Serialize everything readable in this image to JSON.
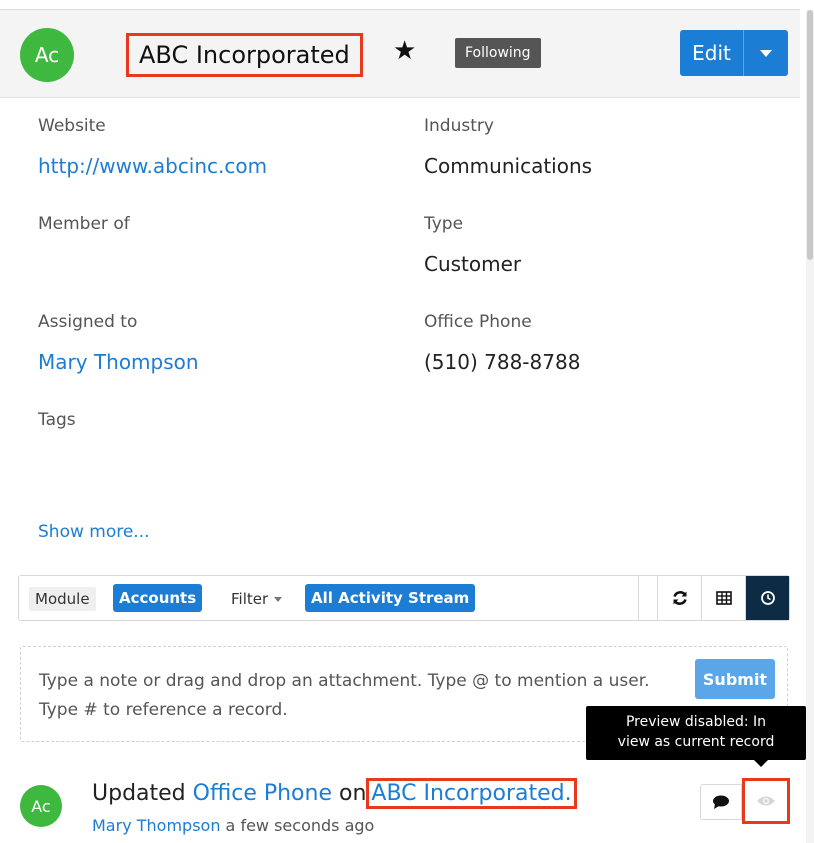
{
  "header": {
    "avatar_initials": "Ac",
    "record_name": "ABC Incorporated",
    "following_label": "Following",
    "edit_label": "Edit"
  },
  "fields": {
    "website_label": "Website",
    "website_value": "http://www.abcinc.com",
    "industry_label": "Industry",
    "industry_value": "Communications",
    "member_of_label": "Member of",
    "type_label": "Type",
    "type_value": "Customer",
    "assigned_label": "Assigned to",
    "assigned_value": "Mary Thompson",
    "phone_label": "Office Phone",
    "phone_value": "(510) 788-8788",
    "tags_label": "Tags",
    "show_more": "Show more..."
  },
  "stream": {
    "module_label": "Module",
    "module_value": "Accounts",
    "filter_label": "Filter",
    "filter_value": "All Activity Stream"
  },
  "note": {
    "placeholder": "Type a note or drag and drop an attachment. Type @ to mention a user. Type # to reference a record.",
    "submit_label": "Submit"
  },
  "tooltip": {
    "line1": "Preview disabled: In",
    "line2": "view as current record"
  },
  "activity": {
    "avatar_initials": "Ac",
    "prefix": "Updated",
    "field_link": "Office Phone",
    "middle": "on",
    "record_link": "ABC Incorporated.",
    "user_link": "Mary Thompson",
    "time": "a few seconds ago"
  }
}
